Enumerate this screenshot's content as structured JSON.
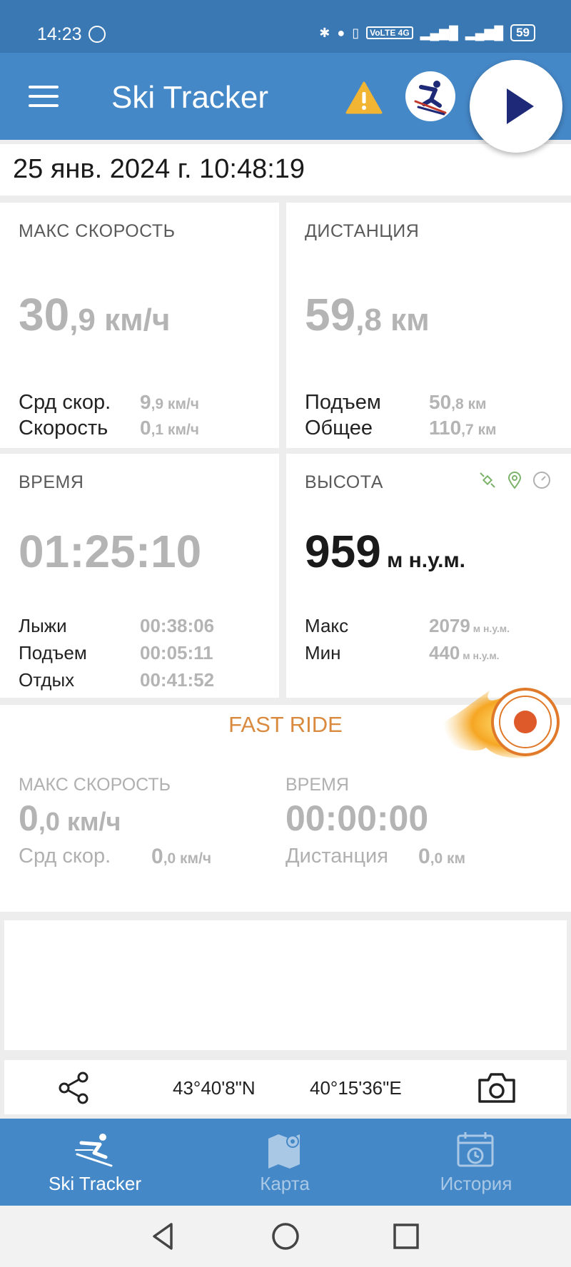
{
  "status_bar": {
    "time": "14:23",
    "indicators": "VoLTE 4G",
    "battery": "59"
  },
  "app_bar": {
    "title": "Ski Tracker",
    "icons": [
      "menu-icon",
      "warning-icon",
      "skier-icon",
      "play-icon"
    ]
  },
  "date": "25 янв. 2024 г. 10:48:19",
  "speed_card": {
    "label": "МАКС СКОРОСТЬ",
    "value_int": "30",
    "value_dec": ",9",
    "unit": " км/ч",
    "avg_label": "Срд скор.",
    "avg_int": "9",
    "avg_dec": ",9",
    "avg_unit": " км/ч",
    "cur_label": "Скорость",
    "cur_int": "0",
    "cur_dec": ",1",
    "cur_unit": " км/ч"
  },
  "distance_card": {
    "label": "ДИСТАНЦИЯ",
    "value_int": "59",
    "value_dec": ",8",
    "unit": " км",
    "lift_label": "Подъем",
    "lift_int": "50",
    "lift_dec": ",8",
    "lift_unit": " км",
    "total_label": "Общее",
    "total_int": "110",
    "total_dec": ",7",
    "total_unit": " км"
  },
  "time_card": {
    "label": "ВРЕМЯ",
    "value": "01:25:10",
    "ski_label": "Лыжи",
    "ski_value": "00:38:06",
    "lift_label": "Подъем",
    "lift_value": "00:05:11",
    "rest_label": "Отдых",
    "rest_value": "00:41:52"
  },
  "altitude_card": {
    "label": "ВЫСОТА",
    "value": "959",
    "unit": " м н.у.м.",
    "max_label": "Макс",
    "max_value": "2079",
    "max_unit": " м н.у.м.",
    "min_label": "Мин",
    "min_value": "440",
    "min_unit": " м н.у.м.",
    "icons": [
      "satellite-icon",
      "location-pin-icon",
      "speedometer-icon"
    ]
  },
  "fast_ride": {
    "title": "FAST RIDE",
    "max_speed_label": "МАКС СКОРОСТЬ",
    "max_speed_int": "0",
    "max_speed_dec": ",0",
    "max_speed_unit": " км/ч",
    "time_label": "ВРЕМЯ",
    "time_value": "00:00:00",
    "avg_label": "Срд скор.",
    "avg_int": "0",
    "avg_dec": ",0",
    "avg_unit": " км/ч",
    "dist_label": "Дистанция",
    "dist_int": "0",
    "dist_dec": ",0",
    "dist_unit": " км"
  },
  "coordinates": {
    "lat": "43°40'8\"N",
    "lon": "40°15'36\"E"
  },
  "bottom_nav": {
    "items": [
      {
        "label": "Ski Tracker",
        "active": true
      },
      {
        "label": "Карта",
        "active": false
      },
      {
        "label": "История",
        "active": false
      }
    ]
  },
  "colors": {
    "primary": "#4588c8",
    "status_bar": "#3a78b4",
    "accent_orange": "#d98a3e",
    "value_gray": "#b4b4b4",
    "play_navy": "#1e2a78"
  }
}
